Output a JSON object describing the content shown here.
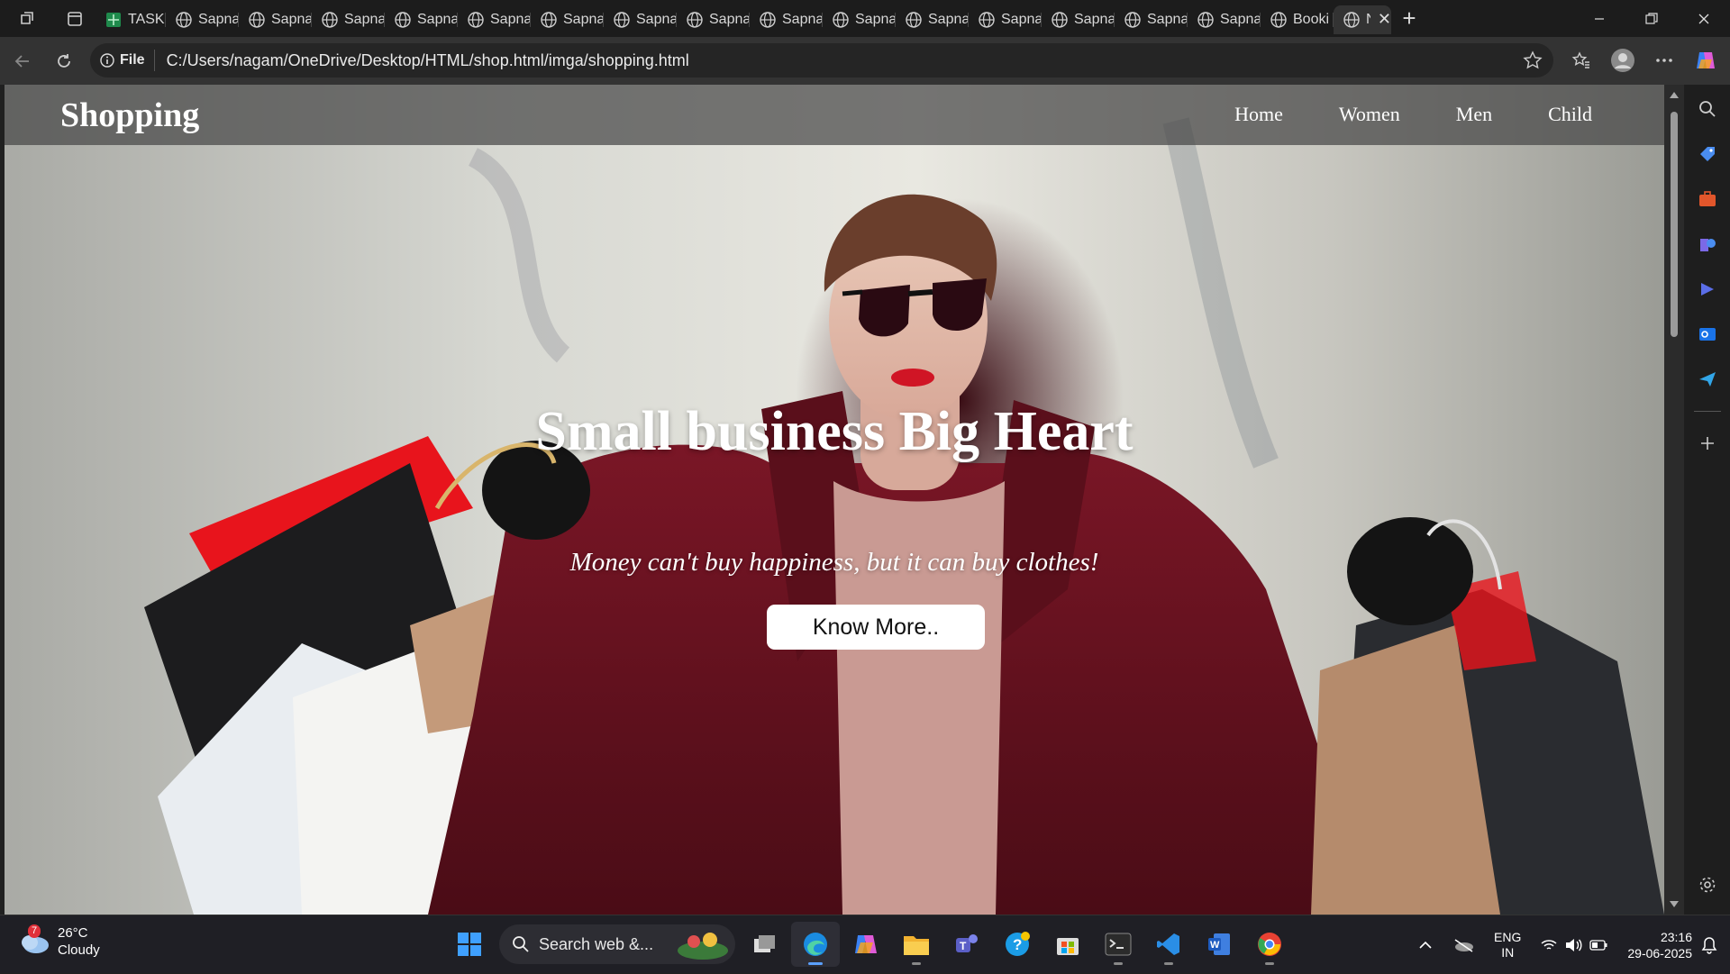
{
  "browser": {
    "tabs": [
      {
        "label": "TASK",
        "kind": "sheet"
      },
      {
        "label": "Sapna",
        "kind": "globe"
      },
      {
        "label": "Sapna",
        "kind": "globe"
      },
      {
        "label": "Sapna",
        "kind": "globe"
      },
      {
        "label": "Sapna",
        "kind": "globe"
      },
      {
        "label": "Sapna",
        "kind": "globe"
      },
      {
        "label": "Sapna",
        "kind": "globe"
      },
      {
        "label": "Sapna",
        "kind": "globe"
      },
      {
        "label": "Sapna",
        "kind": "globe"
      },
      {
        "label": "Sapna",
        "kind": "globe"
      },
      {
        "label": "Sapna",
        "kind": "globe"
      },
      {
        "label": "Sapna",
        "kind": "globe"
      },
      {
        "label": "Sapna",
        "kind": "globe"
      },
      {
        "label": "Sapna",
        "kind": "globe"
      },
      {
        "label": "Sapna",
        "kind": "globe"
      },
      {
        "label": "Sapna",
        "kind": "globe"
      },
      {
        "label": "Booki",
        "kind": "globe"
      },
      {
        "label": "N",
        "kind": "globe",
        "active": true
      }
    ],
    "address": {
      "scheme_label": "File",
      "url": "C:/Users/nagam/OneDrive/Desktop/HTML/shop.html/imga/shopping.html"
    }
  },
  "page": {
    "brand": "Shopping",
    "nav": [
      "Home",
      "Women",
      "Men",
      "Child"
    ],
    "hero": {
      "title": "Small business Big Heart",
      "subtitle": "Money can't buy happiness, but it can buy clothes!",
      "cta": "Know More.."
    }
  },
  "taskbar": {
    "weather": {
      "temp": "26°C",
      "condition": "Cloudy",
      "badge": "7"
    },
    "search_placeholder": "Search web &...",
    "lang": {
      "line1": "ENG",
      "line2": "IN"
    },
    "clock": {
      "time": "23:16",
      "date": "29-06-2025"
    }
  },
  "colors": {
    "accent": "#5aa0ff",
    "coat": "#6b1422",
    "bag_red": "#e8141c"
  }
}
